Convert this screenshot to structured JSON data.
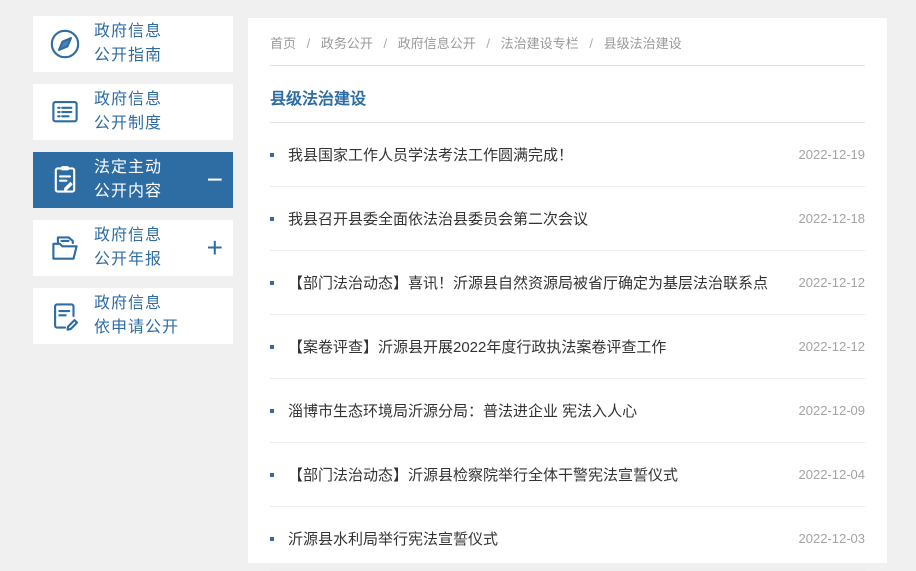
{
  "page": {
    "accent_color": "#2e6da4",
    "background_color": "#f0f0f0"
  },
  "sidebar": {
    "items": [
      {
        "line1": "政府信息",
        "line2": "公开指南",
        "icon": "compass-icon",
        "toggle": ""
      },
      {
        "line1": "政府信息",
        "line2": "公开制度",
        "icon": "document-list-icon",
        "toggle": ""
      },
      {
        "line1": "法定主动",
        "line2": "公开内容",
        "icon": "clipboard-pen-icon",
        "toggle": "−"
      },
      {
        "line1": "政府信息",
        "line2": "公开年报",
        "icon": "folder-icon",
        "toggle": "+"
      },
      {
        "line1": "政府信息",
        "line2": "依申请公开",
        "icon": "document-edit-icon",
        "toggle": ""
      }
    ]
  },
  "breadcrumb": {
    "separator": "/",
    "items": [
      "首页",
      "政务公开",
      "政府信息公开",
      "法治建设专栏",
      "县级法治建设"
    ]
  },
  "main": {
    "title": "县级法治建设",
    "articles": [
      {
        "title": "我县国家工作人员学法考法工作圆满完成！",
        "date": "2022-12-19"
      },
      {
        "title": "我县召开县委全面依法治县委员会第二次会议",
        "date": "2022-12-18"
      },
      {
        "title": "【部门法治动态】喜讯！沂源县自然资源局被省厅确定为基层法治联系点",
        "date": "2022-12-12"
      },
      {
        "title": "【案卷评查】沂源县开展2022年度行政执法案卷评查工作",
        "date": "2022-12-12"
      },
      {
        "title": "淄博市生态环境局沂源分局：普法进企业 宪法入人心",
        "date": "2022-12-09"
      },
      {
        "title": "【部门法治动态】沂源县检察院举行全体干警宪法宣誓仪式",
        "date": "2022-12-04"
      },
      {
        "title": "沂源县水利局举行宪法宣誓仪式",
        "date": "2022-12-03"
      }
    ]
  }
}
